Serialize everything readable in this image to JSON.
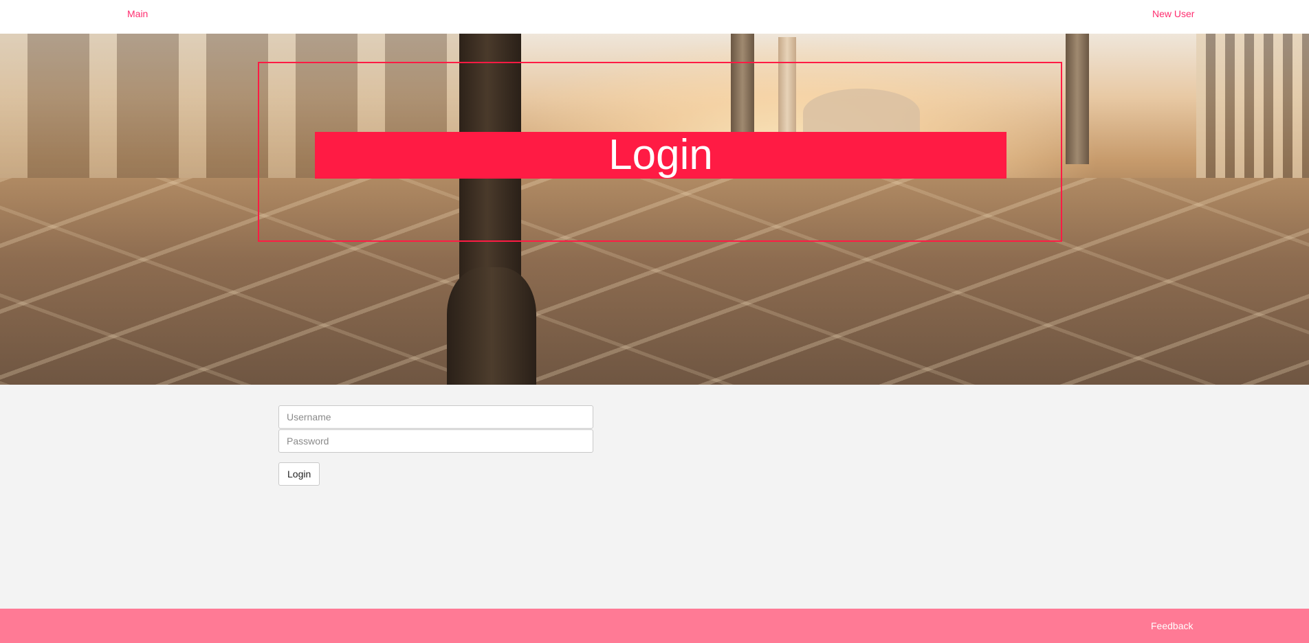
{
  "nav": {
    "main_label": "Main",
    "new_user_label": "New User"
  },
  "hero": {
    "title": "Login"
  },
  "form": {
    "username_placeholder": "Username",
    "password_placeholder": "Password",
    "submit_label": "Login"
  },
  "footer": {
    "feedback_label": "Feedback"
  },
  "colors": {
    "accent": "#ff1b44",
    "nav_link": "#ff2d6f",
    "footer_bg": "#ff7a95",
    "page_bg": "#f3f3f3"
  }
}
